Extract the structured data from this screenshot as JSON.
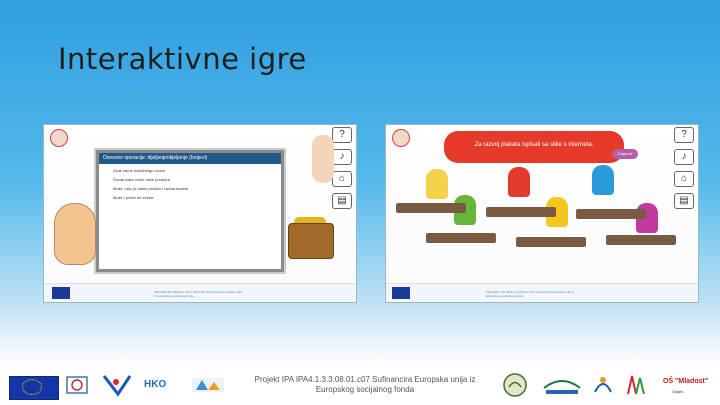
{
  "slide": {
    "title": "Interaktivne igre"
  },
  "screenshot_left": {
    "board_header": "Osnovne operacije: dijeljenje/dijeljenje (brojevi)",
    "board_items": [
      "Zvuk na/ne uzdizbregu zvuce.",
      "Čuvati kako volim neke prostore.",
      "Može i ako je dobro rečeno i uzima desete.",
      "Može i preko ne zveka."
    ],
    "footer_text": "PROJEKTNA IZRADA: 9.5.1.2023.007 Sufinancira Europska unija iz Europskog socijalnog fonda"
  },
  "screenshot_right": {
    "speech_text": "Za razvoj plakata ispisati sa slike s interneta.",
    "odgovor_label": "Odgovor",
    "footer_text": "PROJEKT IPA IPA4.1.3.3.08.01.C07 Sufinancira Europska unija iz Europskog socijalnog fonda"
  },
  "footer": {
    "project_line1": "Projekt IPA IPA4.1.3.3.08.01.c07 Sufinancira Europska unija iz",
    "project_line2": "Europskog socijalnog fonda",
    "hko_label": "HKO",
    "school_name": "OŠ \"Mladost\"",
    "school_sub": "Osijek"
  },
  "colors": {
    "accent": "#2f9fe0",
    "speech": "#e53a2a",
    "eu_blue": "#1536a6"
  }
}
